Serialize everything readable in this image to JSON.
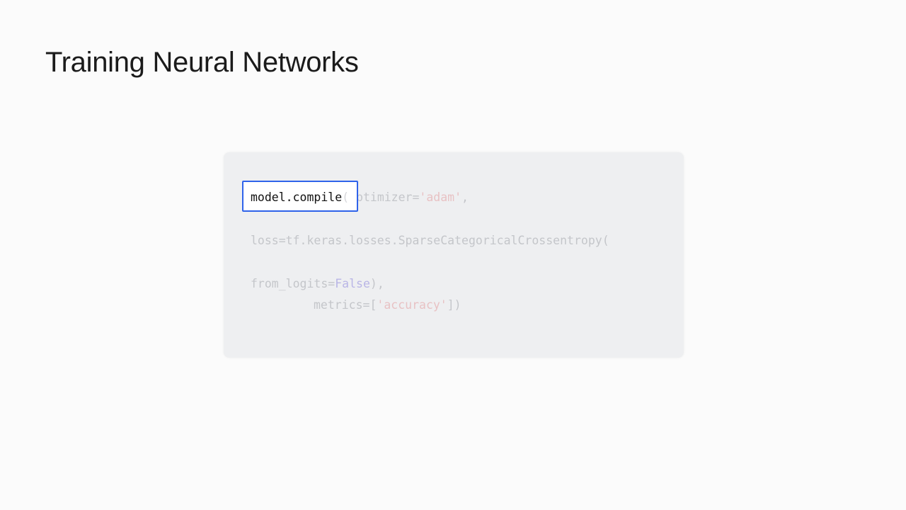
{
  "slide": {
    "title": "Training Neural Networks"
  },
  "code": {
    "highlighted": "model.compile",
    "highlight_tail": "(",
    "line1_rest_a": "optimizer=",
    "line1_str": "'adam'",
    "line1_rest_b": ",",
    "line2": "loss=tf.keras.losses.SparseCategoricalCrossentropy(",
    "line3_a": "from_logits=",
    "line3_kw": "False",
    "line3_b": "),",
    "line4_a": "metrics=[",
    "line4_str": "'accuracy'",
    "line4_b": "])"
  },
  "colors": {
    "highlight_border": "#2f63ea",
    "string": "#e8c2c4",
    "keyword": "#b9b5e6",
    "faded_code": "#c4c6ca",
    "card_background": "#eeeff1"
  }
}
